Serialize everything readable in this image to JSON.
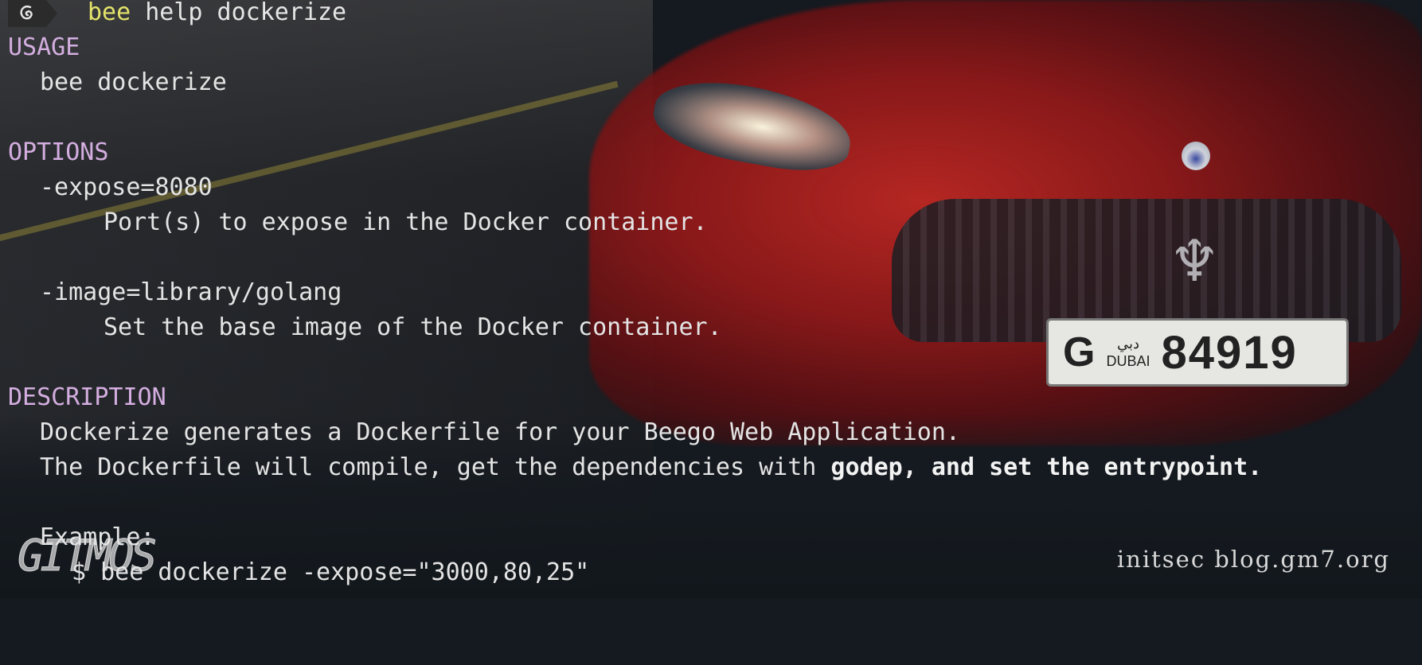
{
  "prompt": {
    "command_bin": "bee",
    "command_args": "help dockerize"
  },
  "usage": {
    "header": "USAGE",
    "line": "bee dockerize"
  },
  "options": {
    "header": "OPTIONS",
    "items": [
      {
        "flag": "-expose=8080",
        "desc": "Port(s) to expose in the Docker container."
      },
      {
        "flag": "-image=library/golang",
        "desc": "Set the base image of the Docker container."
      }
    ]
  },
  "description": {
    "header": "DESCRIPTION",
    "line1": "Dockerize generates a Dockerfile for your Beego Web Application.",
    "line2_plain": "The Dockerfile will compile, get the dependencies with ",
    "line2_bold": "godep, and set the entrypoint.",
    "example_label": "Example:",
    "example_cmd": "$ bee dockerize -expose=\"3000,80,25\""
  },
  "watermarks": {
    "left_logo": "GITMOS",
    "right_text": "initsec blog.gm7.org"
  },
  "plate": {
    "letter": "G",
    "city_ar": "دبي",
    "city": "DUBAI",
    "number": "84919"
  }
}
